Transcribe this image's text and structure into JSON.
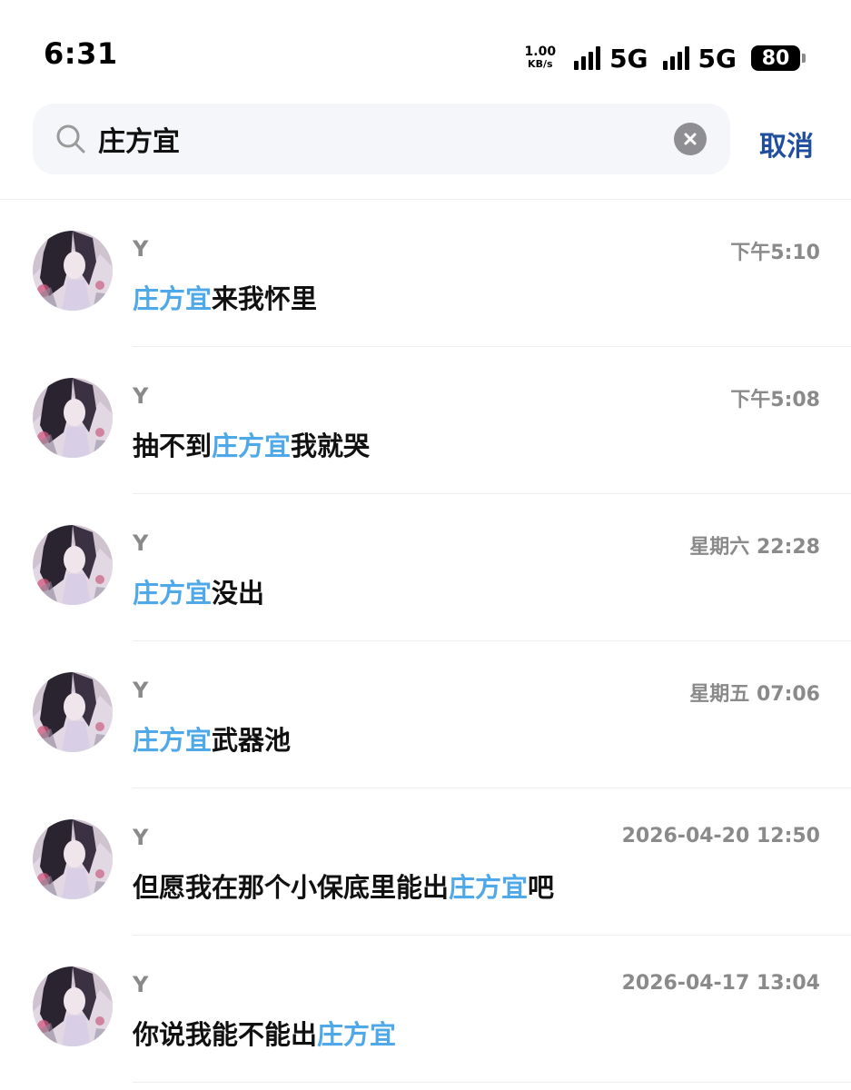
{
  "status_bar": {
    "time": "6:31",
    "net_speed_value": "1.00",
    "net_speed_unit": "KB/s",
    "network_1": "5G",
    "network_2": "5G",
    "battery": "80"
  },
  "search": {
    "query": "庄方宜",
    "cancel_label": "取消",
    "icons": [
      "search-icon",
      "clear-icon"
    ]
  },
  "colors": {
    "highlight": "#4fa8e8",
    "cancel": "#1f4e9c",
    "meta": "#8a8a8a"
  },
  "results": [
    {
      "sender": "Y",
      "time": "下午5:10",
      "before": "",
      "highlight": "庄方宜",
      "after": "来我怀里"
    },
    {
      "sender": "Y",
      "time": "下午5:08",
      "before": "抽不到",
      "highlight": "庄方宜",
      "after": "我就哭"
    },
    {
      "sender": "Y",
      "time": "星期六 22:28",
      "before": "",
      "highlight": "庄方宜",
      "after": "没出"
    },
    {
      "sender": "Y",
      "time": "星期五 07:06",
      "before": "",
      "highlight": "庄方宜",
      "after": "武器池"
    },
    {
      "sender": "Y",
      "time": "2026-04-20 12:50",
      "before": "但愿我在那个小保底里能出",
      "highlight": "庄方宜",
      "after": "吧"
    },
    {
      "sender": "Y",
      "time": "2026-04-17 13:04",
      "before": "你说我能不能出",
      "highlight": "庄方宜",
      "after": ""
    }
  ]
}
